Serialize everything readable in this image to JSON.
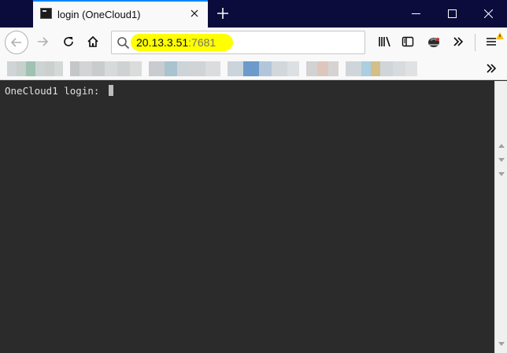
{
  "browser": {
    "tab": {
      "title": "login (OneCloud1)",
      "favicon": "terminal-icon",
      "close_icon": "close-icon"
    },
    "new_tab_icon": "plus-icon",
    "window_controls": [
      "minimize-icon",
      "maximize-icon",
      "close-icon"
    ],
    "nav": {
      "back_icon": "arrow-left-icon",
      "forward_icon": "arrow-right-icon",
      "reload_icon": "reload-icon",
      "home_icon": "home-icon"
    },
    "url": {
      "host": "20.13.3.51",
      "port": ":7681",
      "highlight_color": "#ffff00"
    },
    "toolbar_icons": [
      "library-icon",
      "sidebar-icon",
      "extension-icon",
      "overflow-chevron-icon",
      "menu-icon"
    ],
    "warning_color": "#ffbf00"
  },
  "terminal": {
    "prompt": "OneCloud1 login: ",
    "background": "#2b2b2b",
    "foreground": "#e0e0e0"
  }
}
